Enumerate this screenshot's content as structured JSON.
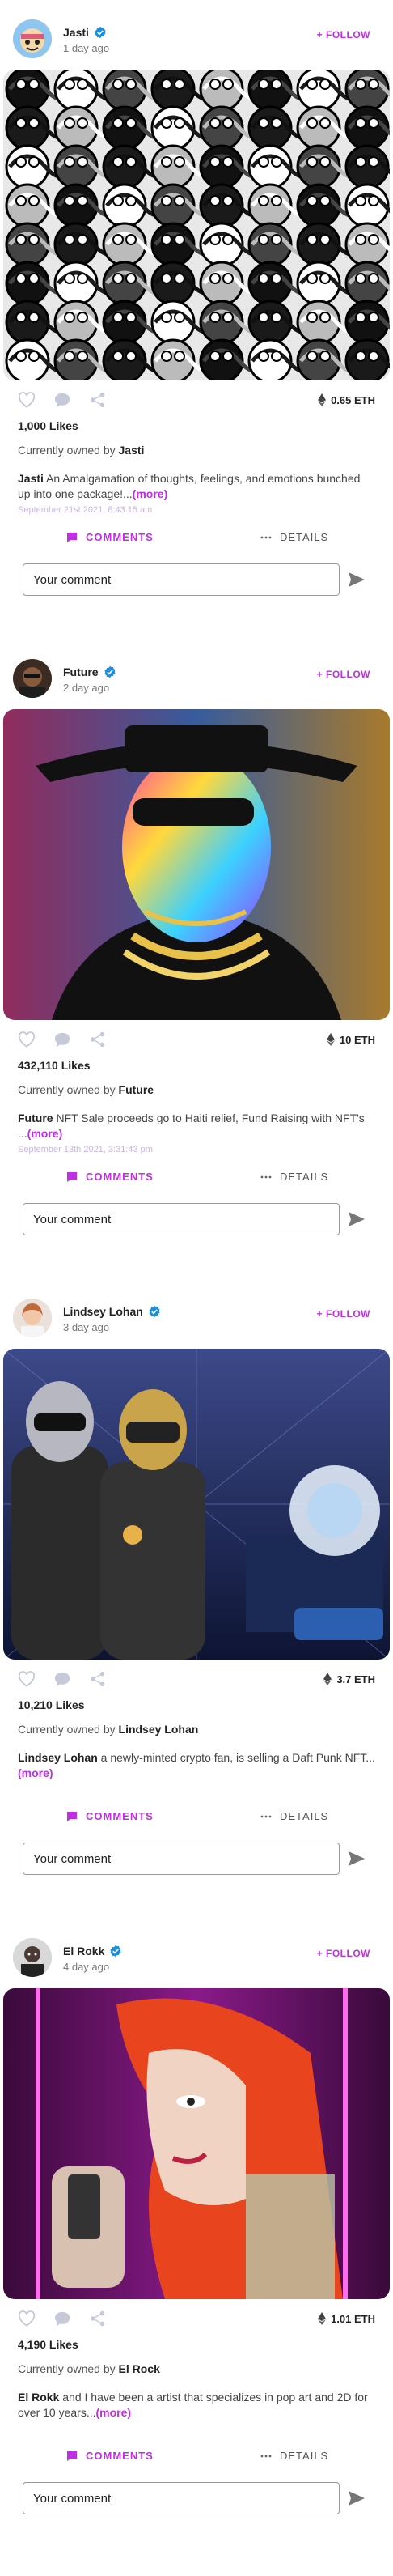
{
  "colors": {
    "accent": "#c02ee6",
    "verified": "#1a8fe0",
    "icon": "#c5c9d8",
    "date": "#c9b6e4"
  },
  "icons": {
    "like": "heart-icon",
    "comment": "chat-bubble-icon",
    "share": "share-icon",
    "currency": "ethereum-icon",
    "send": "send-icon",
    "comments_tab": "comment-square-icon",
    "details_tab": "dots-icon"
  },
  "comment_placeholder": "Your comment",
  "posts": [
    {
      "user": "Jasti",
      "time": "1 day ago",
      "follow": "+ FOLLOW",
      "price": "0.65 ETH",
      "likes": "1,000 Likes",
      "owned_prefix": "Currently owned by ",
      "owner": "Jasti",
      "desc_author": "Jasti",
      "desc_text": " An Amalgamation of thoughts, feelings, and emotions bunched up into one package!...",
      "more": "(more)",
      "date": "September 21st 2021, 8:43:15 am",
      "tab_comments": "COMMENTS",
      "tab_details": "DETAILS"
    },
    {
      "user": "Future",
      "time": "2 day ago",
      "follow": "+ FOLLOW",
      "price": "10 ETH",
      "likes": "432,110 Likes",
      "owned_prefix": "Currently owned by ",
      "owner": "Future",
      "desc_author": "Future",
      "desc_text": " NFT Sale proceeds go to Haiti relief, Fund Raising with NFT's ...",
      "more": "(more)",
      "date": "September 13th 2021, 3:31:43 pm",
      "tab_comments": "COMMENTS",
      "tab_details": "DETAILS"
    },
    {
      "user": "Lindsey Lohan",
      "time": "3 day ago",
      "follow": "+ FOLLOW",
      "price": "3.7 ETH",
      "likes": "10,210 Likes",
      "owned_prefix": "Currently owned by ",
      "owner": "Lindsey Lohan",
      "desc_author": "Lindsey Lohan",
      "desc_text": " a newly-minted crypto fan, is selling a Daft Punk NFT...",
      "more": "(more)",
      "date": "",
      "tab_comments": "COMMENTS",
      "tab_details": "DETAILS"
    },
    {
      "user": "El Rokk",
      "time": "4 day ago",
      "follow": "+ FOLLOW",
      "price": "1.01 ETH",
      "likes": "4,190 Likes",
      "owned_prefix": "Currently owned by ",
      "owner": "El Rock",
      "desc_author": "El Rokk",
      "desc_text": " and I have been a artist that specializes in pop art and 2D for over 10 years...",
      "more": "(more)",
      "date": "",
      "tab_comments": "COMMENTS",
      "tab_details": "DETAILS"
    }
  ]
}
